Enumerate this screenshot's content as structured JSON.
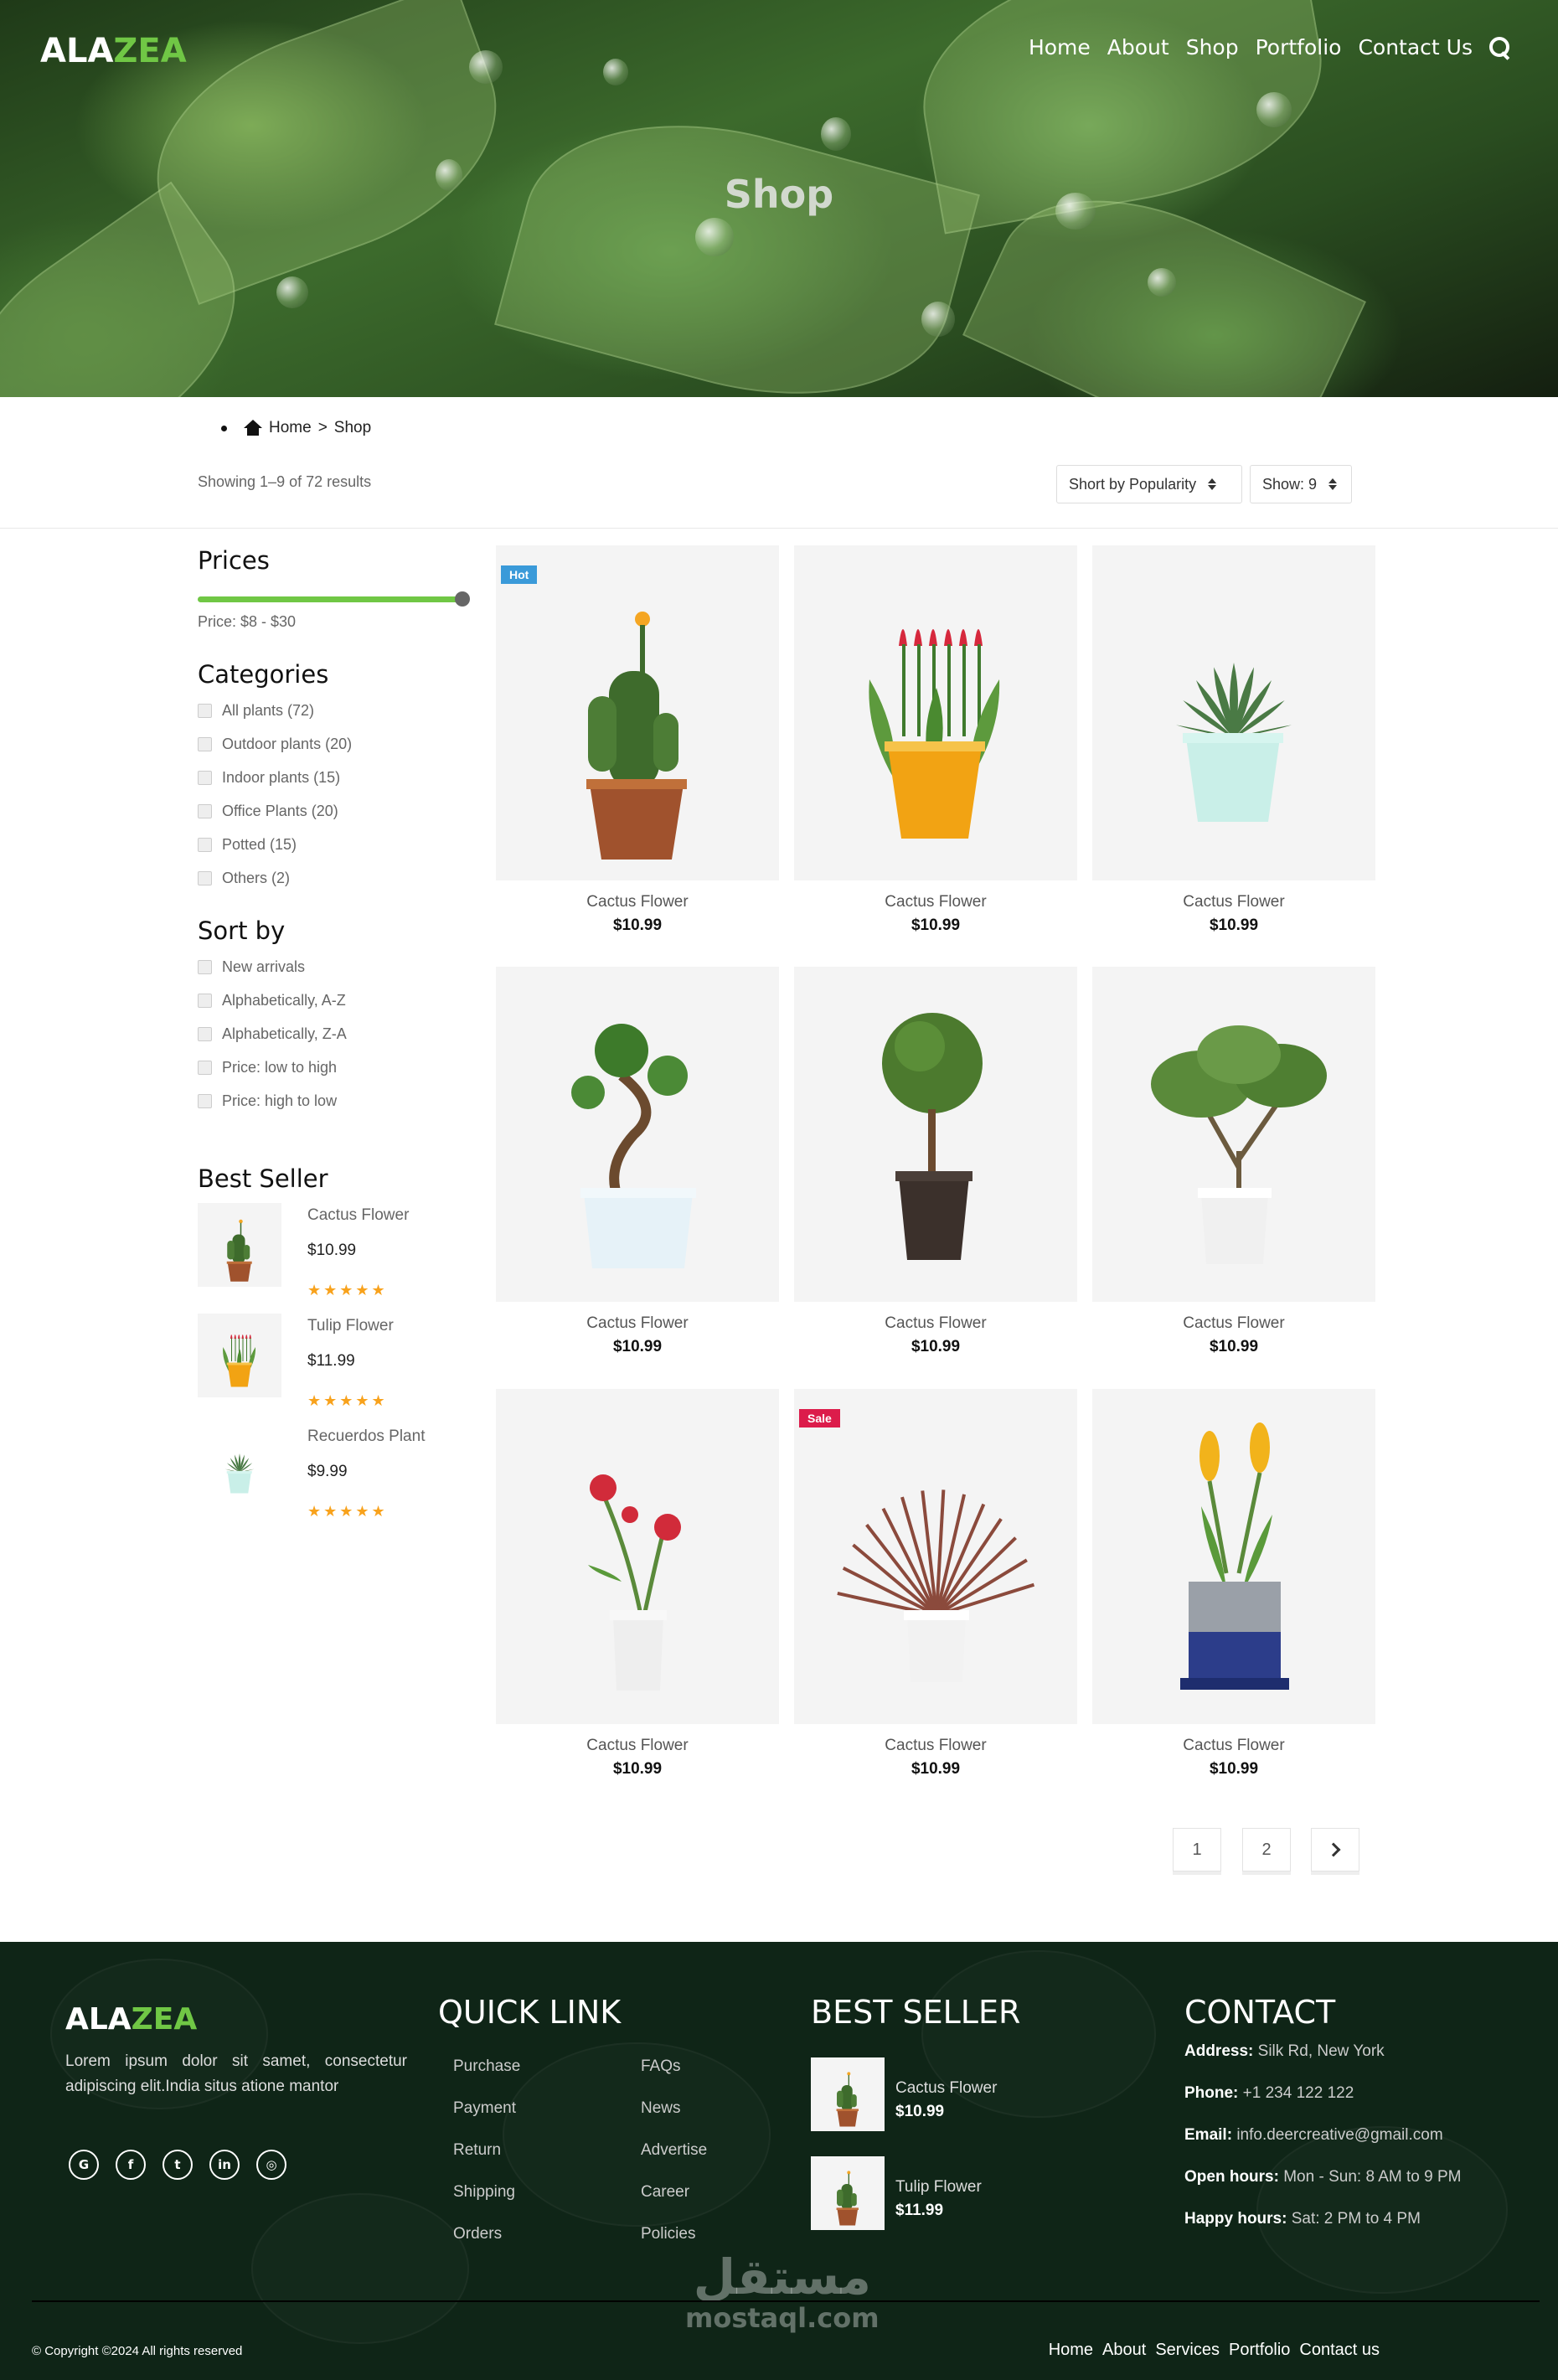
{
  "brand": {
    "part1": "ALA",
    "part2": "ZEA",
    "accent": "#70c745"
  },
  "nav": {
    "items": [
      "Home",
      "About",
      "Shop",
      "Portfolio",
      "Contact Us"
    ],
    "search_icon": "search-icon"
  },
  "hero": {
    "title": "Shop"
  },
  "breadcrumb": {
    "home": "Home",
    "separator": ">",
    "current": "Shop"
  },
  "toolbar": {
    "results": "Showing 1–9 of 72 results",
    "sort_select": "Short by Popularity",
    "show_select": "Show: 9"
  },
  "sidebar": {
    "prices": {
      "title": "Prices",
      "range_label": "Price: $8 - $30",
      "slider_fill": 1.0
    },
    "categories": {
      "title": "Categories",
      "items": [
        "All plants (72)",
        "Outdoor plants (20)",
        "Indoor plants (15)",
        "Office Plants (20)",
        "Potted (15)",
        "Others (2)"
      ]
    },
    "sort": {
      "title": "Sort by",
      "items": [
        "New arrivals",
        "Alphabetically, A-Z",
        "Alphabetically, Z-A",
        "Price: low to high",
        "Price: high to low"
      ]
    },
    "best_seller": {
      "title": "Best Seller",
      "items": [
        {
          "name": "Cactus Flower",
          "price": "$10.99",
          "stars": "★★★★★",
          "rating": 5
        },
        {
          "name": "Tulip Flower",
          "price": "$11.99",
          "stars": "★★★★★",
          "rating": 5
        },
        {
          "name": "Recuerdos Plant",
          "price": "$9.99",
          "stars": "★★★★★",
          "rating": 5
        }
      ]
    }
  },
  "products": [
    {
      "name": "Cactus Flower",
      "price": "$10.99",
      "badge": "Hot",
      "badge_color": "#3a9ad9",
      "plant": "cactus"
    },
    {
      "name": "Cactus Flower",
      "price": "$10.99",
      "badge": "",
      "plant": "tulip"
    },
    {
      "name": "Cactus Flower",
      "price": "$10.99",
      "badge": "",
      "plant": "aloe"
    },
    {
      "name": "Cactus Flower",
      "price": "$10.99",
      "badge": "",
      "plant": "bonsai"
    },
    {
      "name": "Cactus Flower",
      "price": "$10.99",
      "badge": "",
      "plant": "topiary"
    },
    {
      "name": "Cactus Flower",
      "price": "$10.99",
      "badge": "",
      "plant": "olive"
    },
    {
      "name": "Cactus Flower",
      "price": "$10.99",
      "badge": "",
      "plant": "rose"
    },
    {
      "name": "Cactus Flower",
      "price": "$10.99",
      "badge": "Sale",
      "badge_color": "#dc1c4b",
      "plant": "dracaena"
    },
    {
      "name": "Cactus Flower",
      "price": "$10.99",
      "badge": "",
      "plant": "crocus"
    }
  ],
  "pagination": {
    "pages": [
      "1",
      "2"
    ],
    "next_icon": "chevron-right-icon"
  },
  "footer": {
    "about": "Lorem ipsum dolor sit samet, consectetur adipiscing elit.India situs atione mantor",
    "socials": [
      {
        "icon": "google-icon",
        "glyph": "G"
      },
      {
        "icon": "facebook-icon",
        "glyph": "f"
      },
      {
        "icon": "twitter-icon",
        "glyph": "t"
      },
      {
        "icon": "linkedin-icon",
        "glyph": "in"
      },
      {
        "icon": "instagram-icon",
        "glyph": "◎"
      }
    ],
    "quick_link": {
      "title": "QUICK LINK",
      "col1": [
        "Purchase",
        "Payment",
        "Return",
        "Shipping",
        "Orders"
      ],
      "col2": [
        "FAQs",
        "News",
        "Advertise",
        "Career",
        "Policies"
      ]
    },
    "best_seller": {
      "title": "BEST SELLER",
      "items": [
        {
          "name": "Cactus Flower",
          "price": "$10.99"
        },
        {
          "name": "Tulip Flower",
          "price": "$11.99"
        }
      ]
    },
    "contact": {
      "title": "CONTACT",
      "items": [
        {
          "label": "Address:",
          "value": "Silk Rd, New York"
        },
        {
          "label": "Phone:",
          "value": "+1 234 122 122"
        },
        {
          "label": "Email:",
          "value": "info.deercreative@gmail.com"
        },
        {
          "label": "Open hours:",
          "value": "Mon - Sun: 8 AM to 9 PM"
        },
        {
          "label": "Happy hours:",
          "value": "Sat: 2 PM to 4 PM"
        }
      ]
    },
    "copyright": "© Copyright ©2024 All rights reserved",
    "bottom_nav": [
      "Home",
      "About",
      "Services",
      "Portfolio",
      "Contact us"
    ],
    "watermark": {
      "arabic": "مستقل",
      "latin": "mostaql.com"
    }
  }
}
